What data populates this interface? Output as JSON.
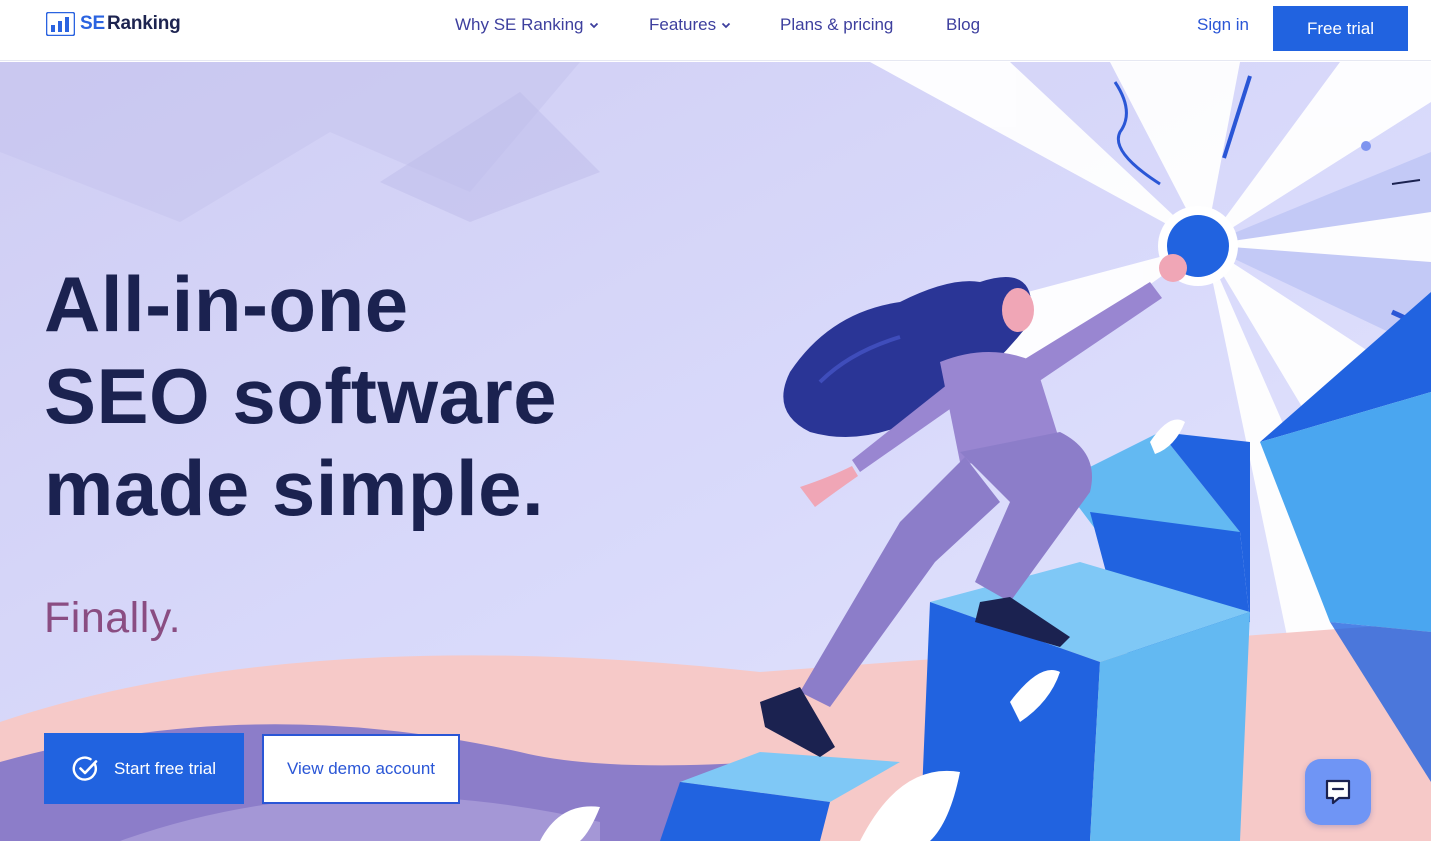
{
  "brand": {
    "logo_prefix": "SE",
    "logo_name": "Ranking",
    "accent_color": "#2163e0",
    "text_color": "#1b2250"
  },
  "nav": {
    "why": "Why SE Ranking",
    "features": "Features",
    "plans": "Plans & pricing",
    "blog": "Blog"
  },
  "header_actions": {
    "sign_in": "Sign in",
    "free_trial": "Free trial"
  },
  "hero": {
    "headline_line1": "All-in-one",
    "headline_line2": "SEO software",
    "headline_line3": "made simple.",
    "tagline": "Finally.",
    "start_trial": "Start free trial",
    "view_demo": "View demo account"
  },
  "icons": {
    "logo": "bar-chart-logo-icon",
    "nav_chevron": "chevron-down-icon",
    "start_trial": "check-circle-icon",
    "chat": "chat-bubble-icon"
  }
}
